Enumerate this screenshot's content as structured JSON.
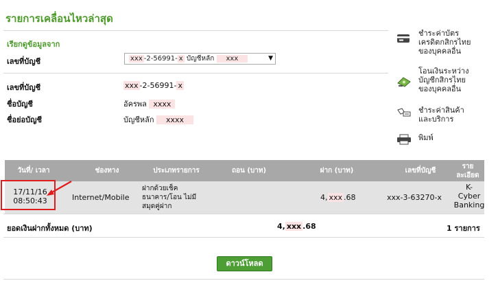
{
  "page_title": "รายการเคลื่อนไหวล่าสุด",
  "query": {
    "section_title": "เรียกดูข้อมูลจาก",
    "account_label": "เลขที่บัญชี",
    "selected_account": {
      "prefix": "xxx",
      "middle": "-2-56991-",
      "suffix": "x",
      "name_label": "บัญชีหลัก",
      "name_mask": "xxx"
    }
  },
  "account_info": {
    "number_label": "เลขที่บัญชี",
    "number_prefix": "xxx",
    "number_middle": "-2-56991-",
    "number_suffix": "x",
    "name_label": "ชื่อบัญชี",
    "name_value": "อัครพล",
    "name_mask": "xxxx",
    "short_name_label": "ชื่อย่อบัญชี",
    "short_name_value": "บัญชีหลัก",
    "short_name_mask": "xxxx"
  },
  "side_menu": [
    {
      "icon": "credit-card-icon",
      "lines": [
        "ชำระค่าบัตร",
        "เครดิตกสิกรไทย",
        "ของบุคคลอื่น"
      ]
    },
    {
      "icon": "money-transfer-icon",
      "lines": [
        "โอนเงินระหว่าง",
        "บัญชีกสิกรไทย",
        "ของบุคคลอื่น"
      ]
    },
    {
      "icon": "bill-payment-icon",
      "lines": [
        "ชำระค่าสินค้า",
        "และบริการ"
      ]
    },
    {
      "icon": "printer-icon",
      "lines": [
        "พิมพ์"
      ]
    }
  ],
  "table": {
    "headers": {
      "date": "วันที่/ เวลา",
      "channel": "ช่องทาง",
      "type": "ประเภทรายการ",
      "withdraw": "ถอน (บาท)",
      "deposit": "ฝาก (บาท)",
      "account": "เลขที่บัญชี",
      "details": "ราย ละเอียด"
    },
    "rows": [
      {
        "date": "17/11/16",
        "time": "08:50:43",
        "channel": "Internet/Mobile",
        "type_lines": [
          "ฝากด้วยเช็ค",
          "ธนาคาร/โอน ไม่มี",
          "สมุดคู่ฝาก"
        ],
        "withdraw": "",
        "deposit_prefix": "4,",
        "deposit_mask": "xxx",
        "deposit_suffix": ".68",
        "account": "xxx-3-63270-x",
        "details_lines": [
          "K-",
          "Cyber",
          "Banking"
        ]
      }
    ],
    "total": {
      "label": "ยอดเงินฝากทั้งหมด (บาท)",
      "amount_prefix": "4,",
      "amount_mask": "xxx",
      "amount_suffix": ".68",
      "count": "1 รายการ"
    }
  },
  "download_label": "ดาวน์โหลด",
  "colors": {
    "accent_green": "#4c9a2a",
    "table_header": "#a8a8a8",
    "table_row": "#e3e3e3",
    "mask_pink": "#fbe3e3",
    "highlight_red": "#e01b1b"
  }
}
